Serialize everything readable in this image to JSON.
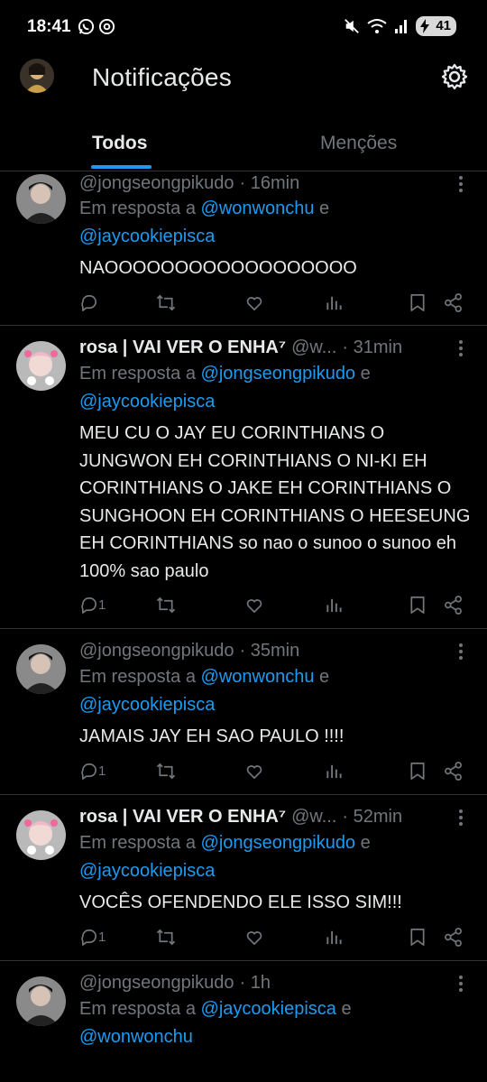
{
  "status_bar": {
    "time": "18:41",
    "battery": "41"
  },
  "header": {
    "title": "Notificações"
  },
  "tabs": [
    {
      "label": "Todos",
      "selected": true
    },
    {
      "label": "Menções",
      "selected": false
    }
  ],
  "colors": {
    "accent": "#1d9bf0",
    "background": "#000000",
    "secondary_text": "#71767b",
    "divider": "#2f3336"
  },
  "tweets": [
    {
      "name": "",
      "handle": "@jongseongpikudo",
      "time": "· 16min",
      "reply_prefix": "Em resposta a ",
      "mention1": "@wonwonchu",
      "joiner": " e",
      "mention2": "@jaycookiepisca",
      "text": "NAOOOOOOOOOOOOOOOOOO",
      "reply_count": ""
    },
    {
      "name": "rosa | VAI VER O ENHA⁷",
      "handle": " @w...",
      "time": " · 31min",
      "reply_prefix": "Em resposta a ",
      "mention1": "@jongseongpikudo",
      "joiner": " e",
      "mention2": "@jaycookiepisca",
      "text": "MEU CU   O JAY EU CORINTHIANS O JUNGWON EH CORINTHIANS O NI-KI EH CORINTHIANS O JAKE EH CORINTHIANS O SUNGHOON EH CORINTHIANS O HEESEUNG EH CORINTHIANS so nao o sunoo o sunoo eh 100% sao paulo",
      "reply_count": "1"
    },
    {
      "name": "",
      "handle": "@jongseongpikudo",
      "time": "· 35min",
      "reply_prefix": "Em resposta a ",
      "mention1": "@wonwonchu",
      "joiner": " e",
      "mention2": "@jaycookiepisca",
      "text": "JAMAIS JAY EH SAO PAULO !!!!",
      "reply_count": "1"
    },
    {
      "name": "rosa | VAI VER O ENHA⁷",
      "handle": " @w...",
      "time": " · 52min",
      "reply_prefix": "Em resposta a ",
      "mention1": "@jongseongpikudo",
      "joiner": " e",
      "mention2": "@jaycookiepisca",
      "text": "VOCÊS OFENDENDO ELE ISSO SIM!!!",
      "reply_count": "1"
    },
    {
      "name": "",
      "handle": "@jongseongpikudo",
      "time": "· 1h",
      "reply_prefix": "Em resposta a ",
      "mention1": "@jaycookiepisca",
      "joiner": " e",
      "mention2": "@wonwonchu",
      "text": "",
      "reply_count": ""
    }
  ],
  "icons": [
    "whatsapp-icon",
    "threads-icon",
    "mute-icon",
    "wifi-icon",
    "signal-icon",
    "battery-icon",
    "settings-gear-icon",
    "reply-icon",
    "retweet-icon",
    "like-icon",
    "views-icon",
    "bookmark-icon",
    "share-icon",
    "more-icon"
  ]
}
